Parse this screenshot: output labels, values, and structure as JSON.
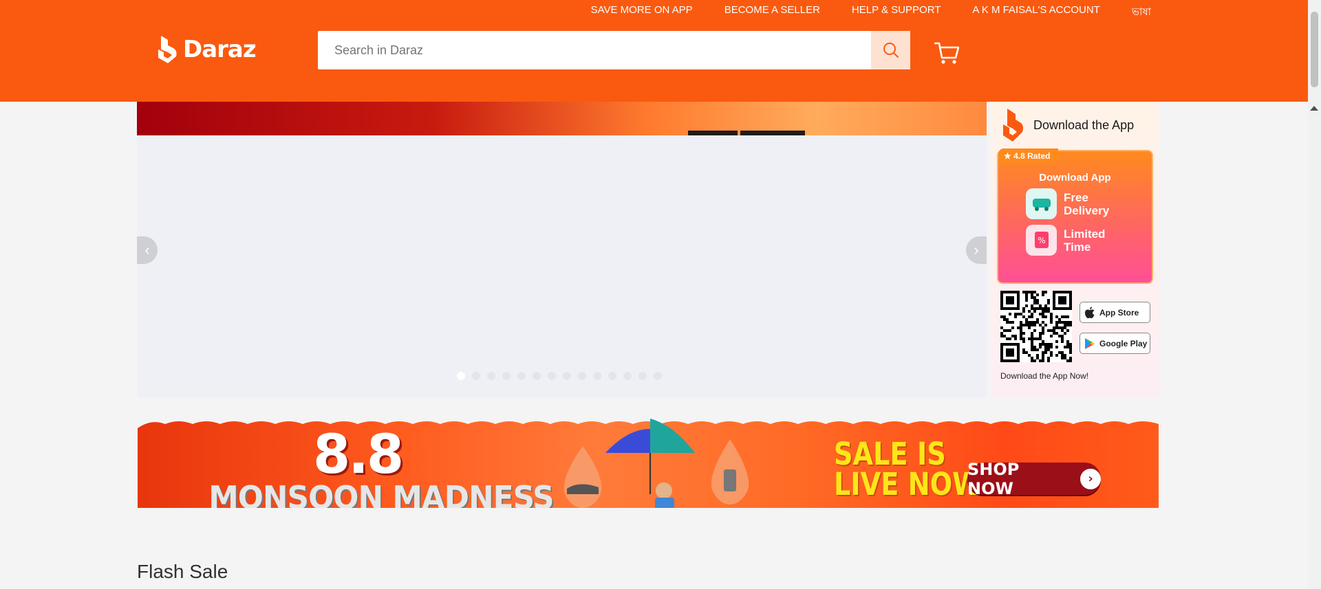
{
  "topnav": {
    "save_more": "SAVE MORE ON APP",
    "become_seller": "BECOME A SELLER",
    "help": "HELP & SUPPORT",
    "account": "A K M FAISAL'S ACCOUNT",
    "language": "ভাষা"
  },
  "header": {
    "logo_text": "Daraz",
    "brand_color": "#fa5a0f"
  },
  "search": {
    "placeholder": "Search in Daraz"
  },
  "slider": {
    "dot_count": 14,
    "active_index": 0
  },
  "app_panel": {
    "title": "Download the App",
    "rating_badge": "4.8 Rated",
    "promo_title": "Download App",
    "features": [
      "Free Delivery",
      "Limited Time"
    ],
    "app_store": "App Store",
    "google_play": "Google Play",
    "footer": "Download the App Now!"
  },
  "banner": {
    "headline": "8.8",
    "campaign": "MONSOON MADNESS",
    "sale_line1": "SALE IS",
    "sale_line2": "LIVE NOW",
    "cta": "SHOP NOW"
  },
  "sections": {
    "flash_sale": "Flash Sale"
  }
}
